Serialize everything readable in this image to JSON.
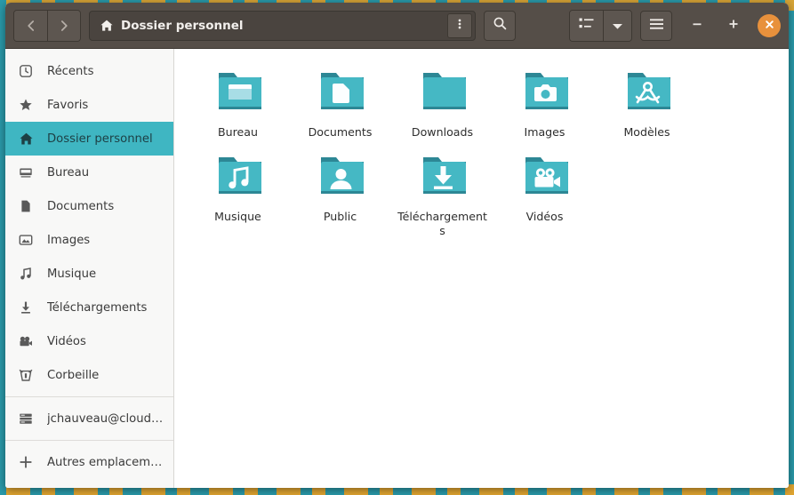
{
  "window": {
    "title": "Dossier personnel",
    "accent_teal": "#3fb6c2",
    "headerbar_bg": "#554e48",
    "close_button_color": "#e8913c"
  },
  "header": {
    "back_icon": "chevron-left-icon",
    "forward_icon": "chevron-right-icon",
    "path_home_icon": "home-icon",
    "path_label": "Dossier personnel",
    "path_menu_icon": "kebab-menu-icon",
    "search_icon": "search-icon",
    "view_list_icon": "list-view-icon",
    "view_dropdown_icon": "chevron-down-icon",
    "main_menu_icon": "hamburger-menu-icon",
    "minimize_label": "–",
    "maximize_label": "+",
    "close_label": "×"
  },
  "sidebar": {
    "items": [
      {
        "label": "Récents",
        "icon": "clock-icon",
        "selected": false
      },
      {
        "label": "Favoris",
        "icon": "star-icon",
        "selected": false
      },
      {
        "label": "Dossier personnel",
        "icon": "home-icon",
        "selected": true
      },
      {
        "label": "Bureau",
        "icon": "desktop-icon",
        "selected": false
      },
      {
        "label": "Documents",
        "icon": "document-icon",
        "selected": false
      },
      {
        "label": "Images",
        "icon": "picture-icon",
        "selected": false
      },
      {
        "label": "Musique",
        "icon": "music-note-icon",
        "selected": false
      },
      {
        "label": "Téléchargements",
        "icon": "download-icon",
        "selected": false
      },
      {
        "label": "Vidéos",
        "icon": "video-camera-icon",
        "selected": false
      },
      {
        "label": "Corbeille",
        "icon": "trash-icon",
        "selected": false
      }
    ],
    "account": {
      "label": "jchauveau@cloud.a…",
      "icon": "server-icon"
    },
    "other_locations": {
      "label": "Autres emplacements",
      "icon": "plus-icon"
    }
  },
  "content": {
    "files": [
      {
        "label": "Bureau",
        "icon": "folder-desktop-icon"
      },
      {
        "label": "Documents",
        "icon": "folder-documents-icon"
      },
      {
        "label": "Downloads",
        "icon": "folder-plain-icon"
      },
      {
        "label": "Images",
        "icon": "folder-pictures-icon"
      },
      {
        "label": "Modèles",
        "icon": "folder-templates-icon"
      },
      {
        "label": "Musique",
        "icon": "folder-music-icon"
      },
      {
        "label": "Public",
        "icon": "folder-public-icon"
      },
      {
        "label": "Téléchargements",
        "icon": "folder-downloads-icon"
      },
      {
        "label": "Vidéos",
        "icon": "folder-videos-icon"
      }
    ]
  }
}
